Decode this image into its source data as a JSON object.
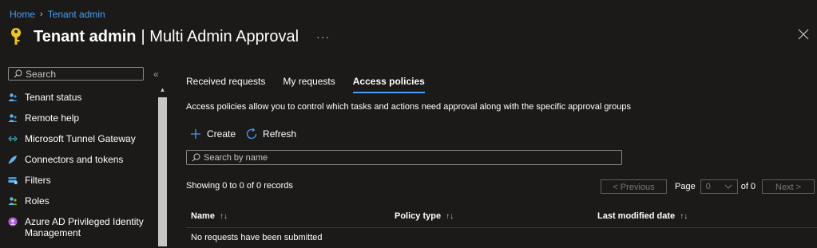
{
  "breadcrumb": {
    "home": "Home",
    "current": "Tenant admin"
  },
  "header": {
    "title_bold": "Tenant admin",
    "title_light": "| Multi Admin Approval",
    "more": "···"
  },
  "sidebar": {
    "search_placeholder": "Search",
    "collapse": "«",
    "items": [
      {
        "label": "Tenant status",
        "icon": "people-icon"
      },
      {
        "label": "Remote help",
        "icon": "people-icon"
      },
      {
        "label": "Microsoft Tunnel Gateway",
        "icon": "arrows-icon"
      },
      {
        "label": "Connectors and tokens",
        "icon": "rocket-icon"
      },
      {
        "label": "Filters",
        "icon": "filter-icon"
      },
      {
        "label": "Roles",
        "icon": "people-icon"
      },
      {
        "label": "Azure AD Privileged Identity Management",
        "icon": "identity-icon"
      }
    ]
  },
  "tabs": [
    {
      "label": "Received requests"
    },
    {
      "label": "My requests"
    },
    {
      "label": "Access policies"
    }
  ],
  "description": "Access policies allow you to control which tasks and actions need approval along with the specific approval groups",
  "toolbar": {
    "create": "Create",
    "refresh": "Refresh"
  },
  "name_search_placeholder": "Search by name",
  "records": "Showing 0 to 0 of 0 records",
  "pager": {
    "previous": "< Previous",
    "page_label": "Page",
    "page_value": "0",
    "of": "of 0",
    "next": "Next >"
  },
  "table": {
    "columns": [
      "Name",
      "Policy type",
      "Last modified date"
    ],
    "sort_name": "↑↓",
    "sort_type": "↑↓",
    "sort_date": "↑↓",
    "empty": "No requests have been submitted"
  },
  "colors": {
    "accent": "#479ef5",
    "background": "#1b1a19",
    "key_icon": "#f2c811"
  }
}
